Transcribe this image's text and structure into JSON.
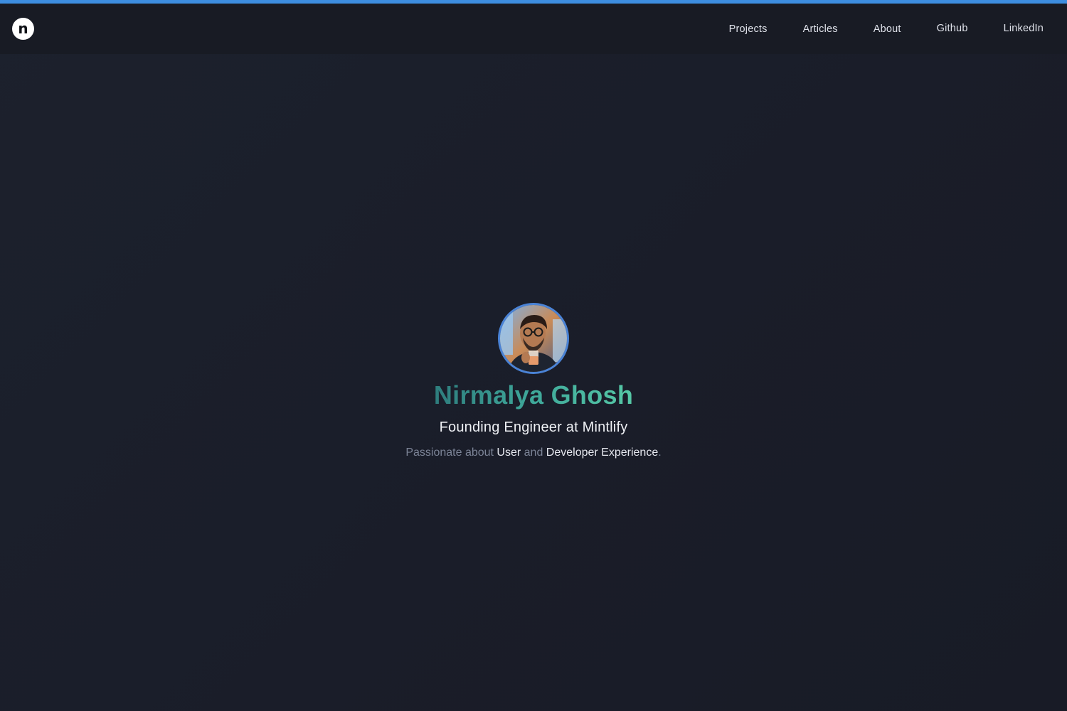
{
  "header": {
    "logo_letter": "n",
    "nav": [
      {
        "label": "Projects"
      },
      {
        "label": "Articles"
      },
      {
        "label": "About"
      },
      {
        "label": "Github"
      },
      {
        "label": "LinkedIn"
      }
    ]
  },
  "hero": {
    "name": "Nirmalya Ghosh",
    "role": "Founding Engineer at Mintlify",
    "tagline": {
      "part1": "Passionate about ",
      "highlight1": "User",
      "part2": " and ",
      "highlight2": "Developer Experience",
      "part3": "."
    }
  },
  "colors": {
    "accent_bar": "#3d8ee0",
    "background": "#1a1d29",
    "name_gradient_start": "#2e7d7d",
    "name_gradient_end": "#56c8a6",
    "avatar_border": "#4a83d6"
  }
}
